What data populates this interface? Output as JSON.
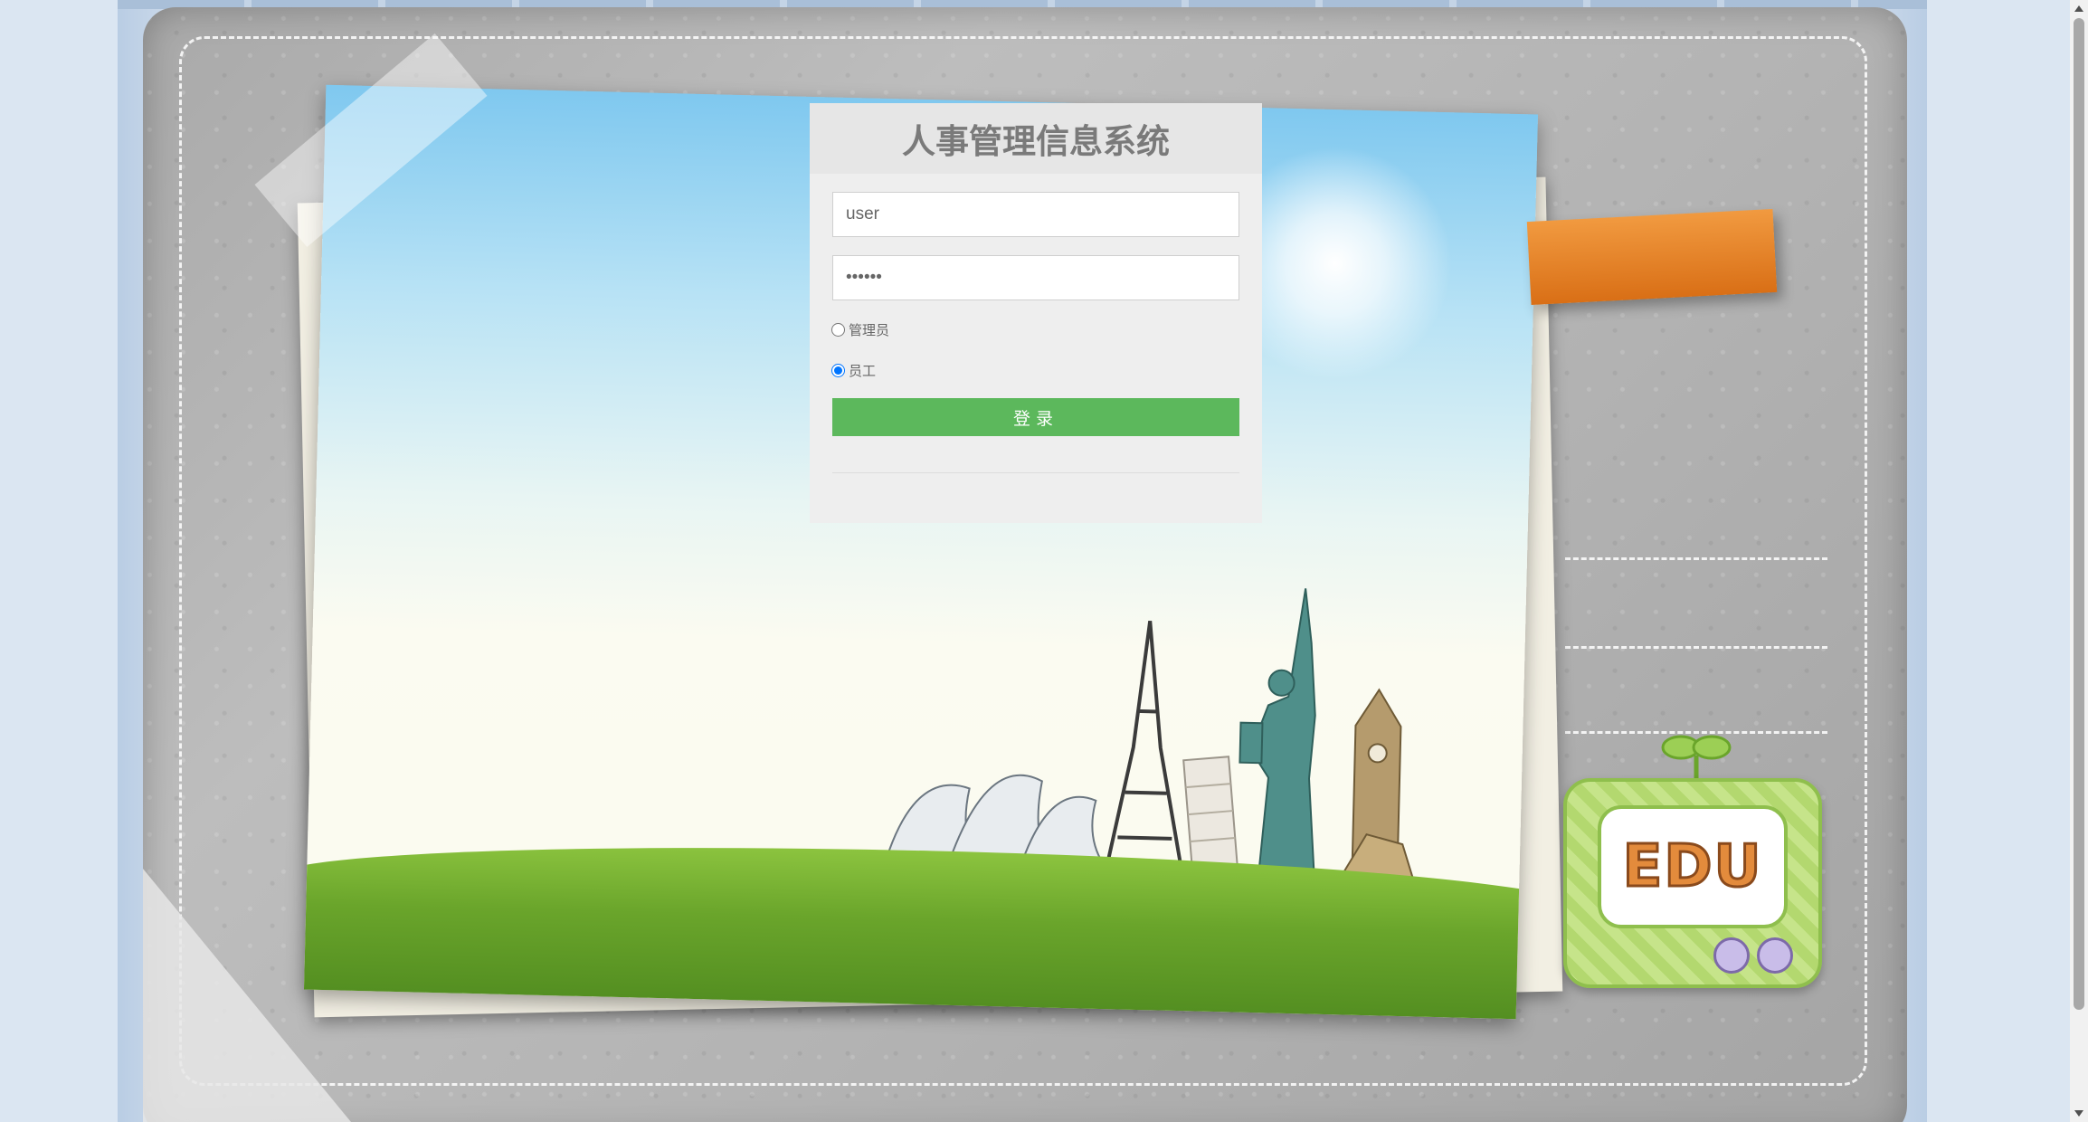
{
  "login": {
    "title": "人事管理信息系统",
    "username": {
      "value": "user",
      "placeholder": ""
    },
    "password": {
      "value": "••••••",
      "placeholder": ""
    },
    "roles": [
      {
        "label": "管理员",
        "checked": false
      },
      {
        "label": "员工",
        "checked": true
      }
    ],
    "submit_label": "登录"
  },
  "decor": {
    "tv_text": "EDU"
  },
  "colors": {
    "accent_green": "#5cb85c",
    "ribbon_orange": "#e8842a"
  }
}
